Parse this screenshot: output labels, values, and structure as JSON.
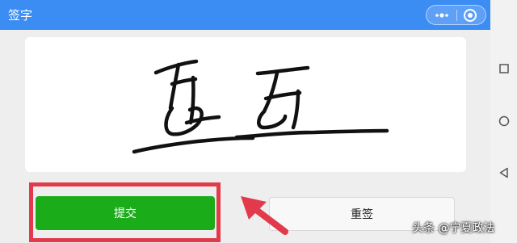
{
  "window": {
    "title": "签字"
  },
  "capsule": {
    "menu_icon": "more-dots-icon",
    "close_icon": "target-close-icon"
  },
  "signature": {
    "content": "handwritten signature drawing",
    "ink_color": "#111111"
  },
  "buttons": {
    "submit_label": "提交",
    "resign_label": "重签"
  },
  "annotation": {
    "color": "#e23a4b"
  },
  "watermark": {
    "text": "头条 @宁夏政法"
  },
  "navigation": {
    "items": [
      "recent-apps-icon",
      "home-icon",
      "back-icon"
    ]
  },
  "colors": {
    "header": "#3b8cf3",
    "submit": "#1aad19"
  }
}
